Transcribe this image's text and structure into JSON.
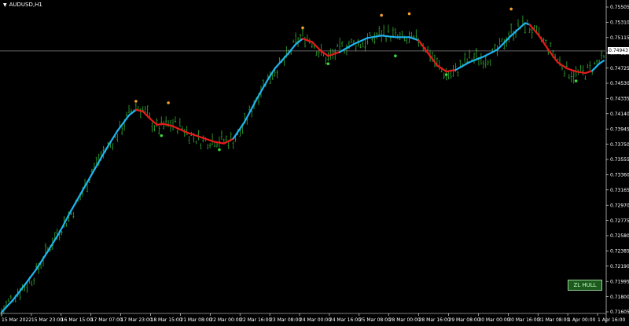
{
  "symbol": "AUDUSD,H1",
  "current_price": "0.74943",
  "indicator_badge": "ZL HULL",
  "icons": {
    "symbol_menu": "triangle-down-icon"
  },
  "colors": {
    "background": "#000000",
    "bars": "#2e9a2e",
    "hull_up": "#1fb4f0",
    "hull_down": "#e81a1a",
    "signal_high": "#f3a02e",
    "signal_low": "#3ad83a",
    "axis_text": "#ffffff",
    "price_line": "#8a8a8a",
    "badge_bg": "#1d5a1d"
  },
  "chart_data": {
    "type": "line",
    "title": "",
    "price_axis_ticks": [
      "0.75505",
      "0.75310",
      "0.75115",
      "0.74920",
      "0.74725",
      "0.74530",
      "0.74335",
      "0.74140",
      "0.73945",
      "0.73750",
      "0.73555",
      "0.73360",
      "0.73165",
      "0.72970",
      "0.72775",
      "0.72580",
      "0.72385",
      "0.72190",
      "0.71995",
      "0.71800",
      "0.71605"
    ],
    "time_axis_labels": [
      "15 Mar 2022",
      "15 Mar 23:00",
      "16 Mar 15:00",
      "17 Mar 07:00",
      "17 Mar 23:00",
      "18 Mar 15:00",
      "21 Mar 08:00",
      "22 Mar 00:00",
      "22 Mar 16:00",
      "23 Mar 08:00",
      "24 Mar 00:00",
      "24 Mar 16:00",
      "25 Mar 08:00",
      "28 Mar 00:00",
      "28 Mar 16:00",
      "29 Mar 08:00",
      "30 Mar 00:00",
      "30 Mar 16:00",
      "31 Mar 08:00",
      "1 Apr 00:00",
      "1 Apr 16:00"
    ],
    "ylim": [
      0.71605,
      0.75505
    ],
    "current_price": 0.74943,
    "hull_series": {
      "name": "",
      "points": [
        [
          0,
          0.716
        ],
        [
          5,
          0.7176
        ],
        [
          10,
          0.7195
        ],
        [
          15,
          0.7215
        ],
        [
          20,
          0.7238
        ],
        [
          25,
          0.7262
        ],
        [
          30,
          0.729
        ],
        [
          35,
          0.7316
        ],
        [
          40,
          0.7342
        ],
        [
          45,
          0.7368
        ],
        [
          50,
          0.7392
        ],
        [
          55,
          0.7412
        ],
        [
          58,
          0.7419
        ],
        [
          61,
          0.7417
        ],
        [
          64,
          0.7408
        ],
        [
          67,
          0.74
        ],
        [
          70,
          0.7401
        ],
        [
          74,
          0.7398
        ],
        [
          80,
          0.739
        ],
        [
          86,
          0.7384
        ],
        [
          92,
          0.7378
        ],
        [
          96,
          0.7376
        ],
        [
          100,
          0.7382
        ],
        [
          105,
          0.7404
        ],
        [
          110,
          0.7432
        ],
        [
          115,
          0.7458
        ],
        [
          118,
          0.7472
        ],
        [
          121,
          0.7482
        ],
        [
          124,
          0.7492
        ],
        [
          127,
          0.7503
        ],
        [
          130,
          0.751
        ],
        [
          134,
          0.7506
        ],
        [
          138,
          0.7494
        ],
        [
          141,
          0.7488
        ],
        [
          146,
          0.7493
        ],
        [
          152,
          0.7503
        ],
        [
          158,
          0.7511
        ],
        [
          164,
          0.7514
        ],
        [
          170,
          0.7512
        ],
        [
          176,
          0.7512
        ],
        [
          180,
          0.7508
        ],
        [
          184,
          0.7492
        ],
        [
          188,
          0.7476
        ],
        [
          192,
          0.7468
        ],
        [
          196,
          0.747
        ],
        [
          202,
          0.748
        ],
        [
          208,
          0.7487
        ],
        [
          214,
          0.7496
        ],
        [
          220,
          0.7514
        ],
        [
          226,
          0.753
        ],
        [
          228,
          0.7528
        ],
        [
          232,
          0.7514
        ],
        [
          236,
          0.7496
        ],
        [
          240,
          0.748
        ],
        [
          244,
          0.7472
        ],
        [
          248,
          0.7468
        ],
        [
          252,
          0.7466
        ],
        [
          255,
          0.7469
        ],
        [
          258,
          0.7478
        ],
        [
          260,
          0.7482
        ]
      ],
      "colors": [
        "up",
        "up",
        "up",
        "up",
        "up",
        "up",
        "up",
        "up",
        "up",
        "up",
        "up",
        "up",
        "down",
        "down",
        "down",
        "down",
        "down",
        "down",
        "down",
        "down",
        "down",
        "down",
        "up",
        "up",
        "up",
        "up",
        "up",
        "up",
        "up",
        "up",
        "down",
        "down",
        "down",
        "down",
        "up",
        "up",
        "up",
        "up",
        "up",
        "up",
        "down",
        "down",
        "down",
        "down",
        "up",
        "up",
        "up",
        "up",
        "up",
        "up",
        "down",
        "down",
        "down",
        "down",
        "down",
        "down",
        "down",
        "up",
        "up",
        "up"
      ]
    },
    "signals_high": [
      [
        58,
        0.743
      ],
      [
        72,
        0.7428
      ],
      [
        130,
        0.7524
      ],
      [
        164,
        0.754
      ],
      [
        176,
        0.7542
      ],
      [
        220,
        0.7548
      ]
    ],
    "signals_low": [
      [
        69,
        0.7386
      ],
      [
        94,
        0.7368
      ],
      [
        141,
        0.7478
      ],
      [
        170,
        0.7488
      ],
      [
        192,
        0.7464
      ],
      [
        248,
        0.7456
      ]
    ]
  }
}
